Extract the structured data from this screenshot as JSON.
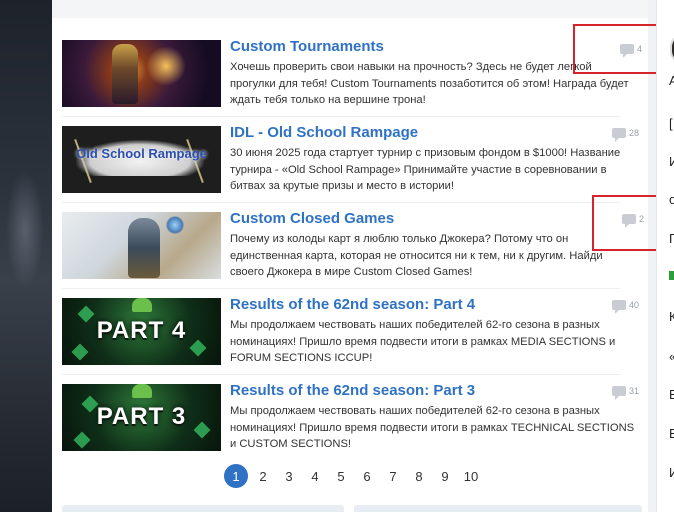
{
  "articles": [
    {
      "title": "Custom Tournaments",
      "description": "Хочешь проверить свои навыки на прочность? Здесь не будет легкой прогулки для тебя! Custom Tournaments позаботится об этом! Награда будет ждать тебя только на вершине трона!",
      "comments": "4"
    },
    {
      "title": "IDL - Old School Rampage",
      "description": "30 июня 2025 года стартует турнир с призовым фондом в $1000! Название турнира - «Old School Rampage» Принимайте участие в соревновании в битвах за крутые призы и место в истории!",
      "comments": "28",
      "thumb_text": "Old School Rampage"
    },
    {
      "title": "Custom Closed Games",
      "description": "Почему из колоды карт я люблю только Джокера? Потому что он единственная карта, которая не относится ни к тем, ни к другим. Найди своего Джокера в мире Custom Closed Games!",
      "comments": "2"
    },
    {
      "title": "Results of the 62nd season: Part 4",
      "description": "Мы продолжаем чествовать наших победителей 62-го сезона в разных номинациях! Пришло время подвести итоги в рамках MEDIA SECTIONS и FORUM SECTIONS ICCUP!",
      "comments": "40",
      "thumb_text": "PART 4"
    },
    {
      "title": "Results of the 62nd season: Part 3",
      "description": "Мы продолжаем чествовать наших победителей 62-го сезона в разных номинациях! Пришло время подвести итоги в рамках TECHNICAL SECTIONS и CUSTOM SECTIONS!",
      "comments": "31",
      "thumb_text": "PART 3"
    }
  ],
  "pagination": {
    "pages": [
      "1",
      "2",
      "3",
      "4",
      "5",
      "6",
      "7",
      "8",
      "9",
      "10"
    ],
    "current": "1"
  },
  "right_column": {
    "chars": [
      "А",
      "[",
      "И",
      "о",
      "Г",
      "К",
      "«",
      "В",
      "В",
      "И"
    ]
  },
  "colors": {
    "link": "#2f72c4",
    "highlight": "#d6232c"
  }
}
